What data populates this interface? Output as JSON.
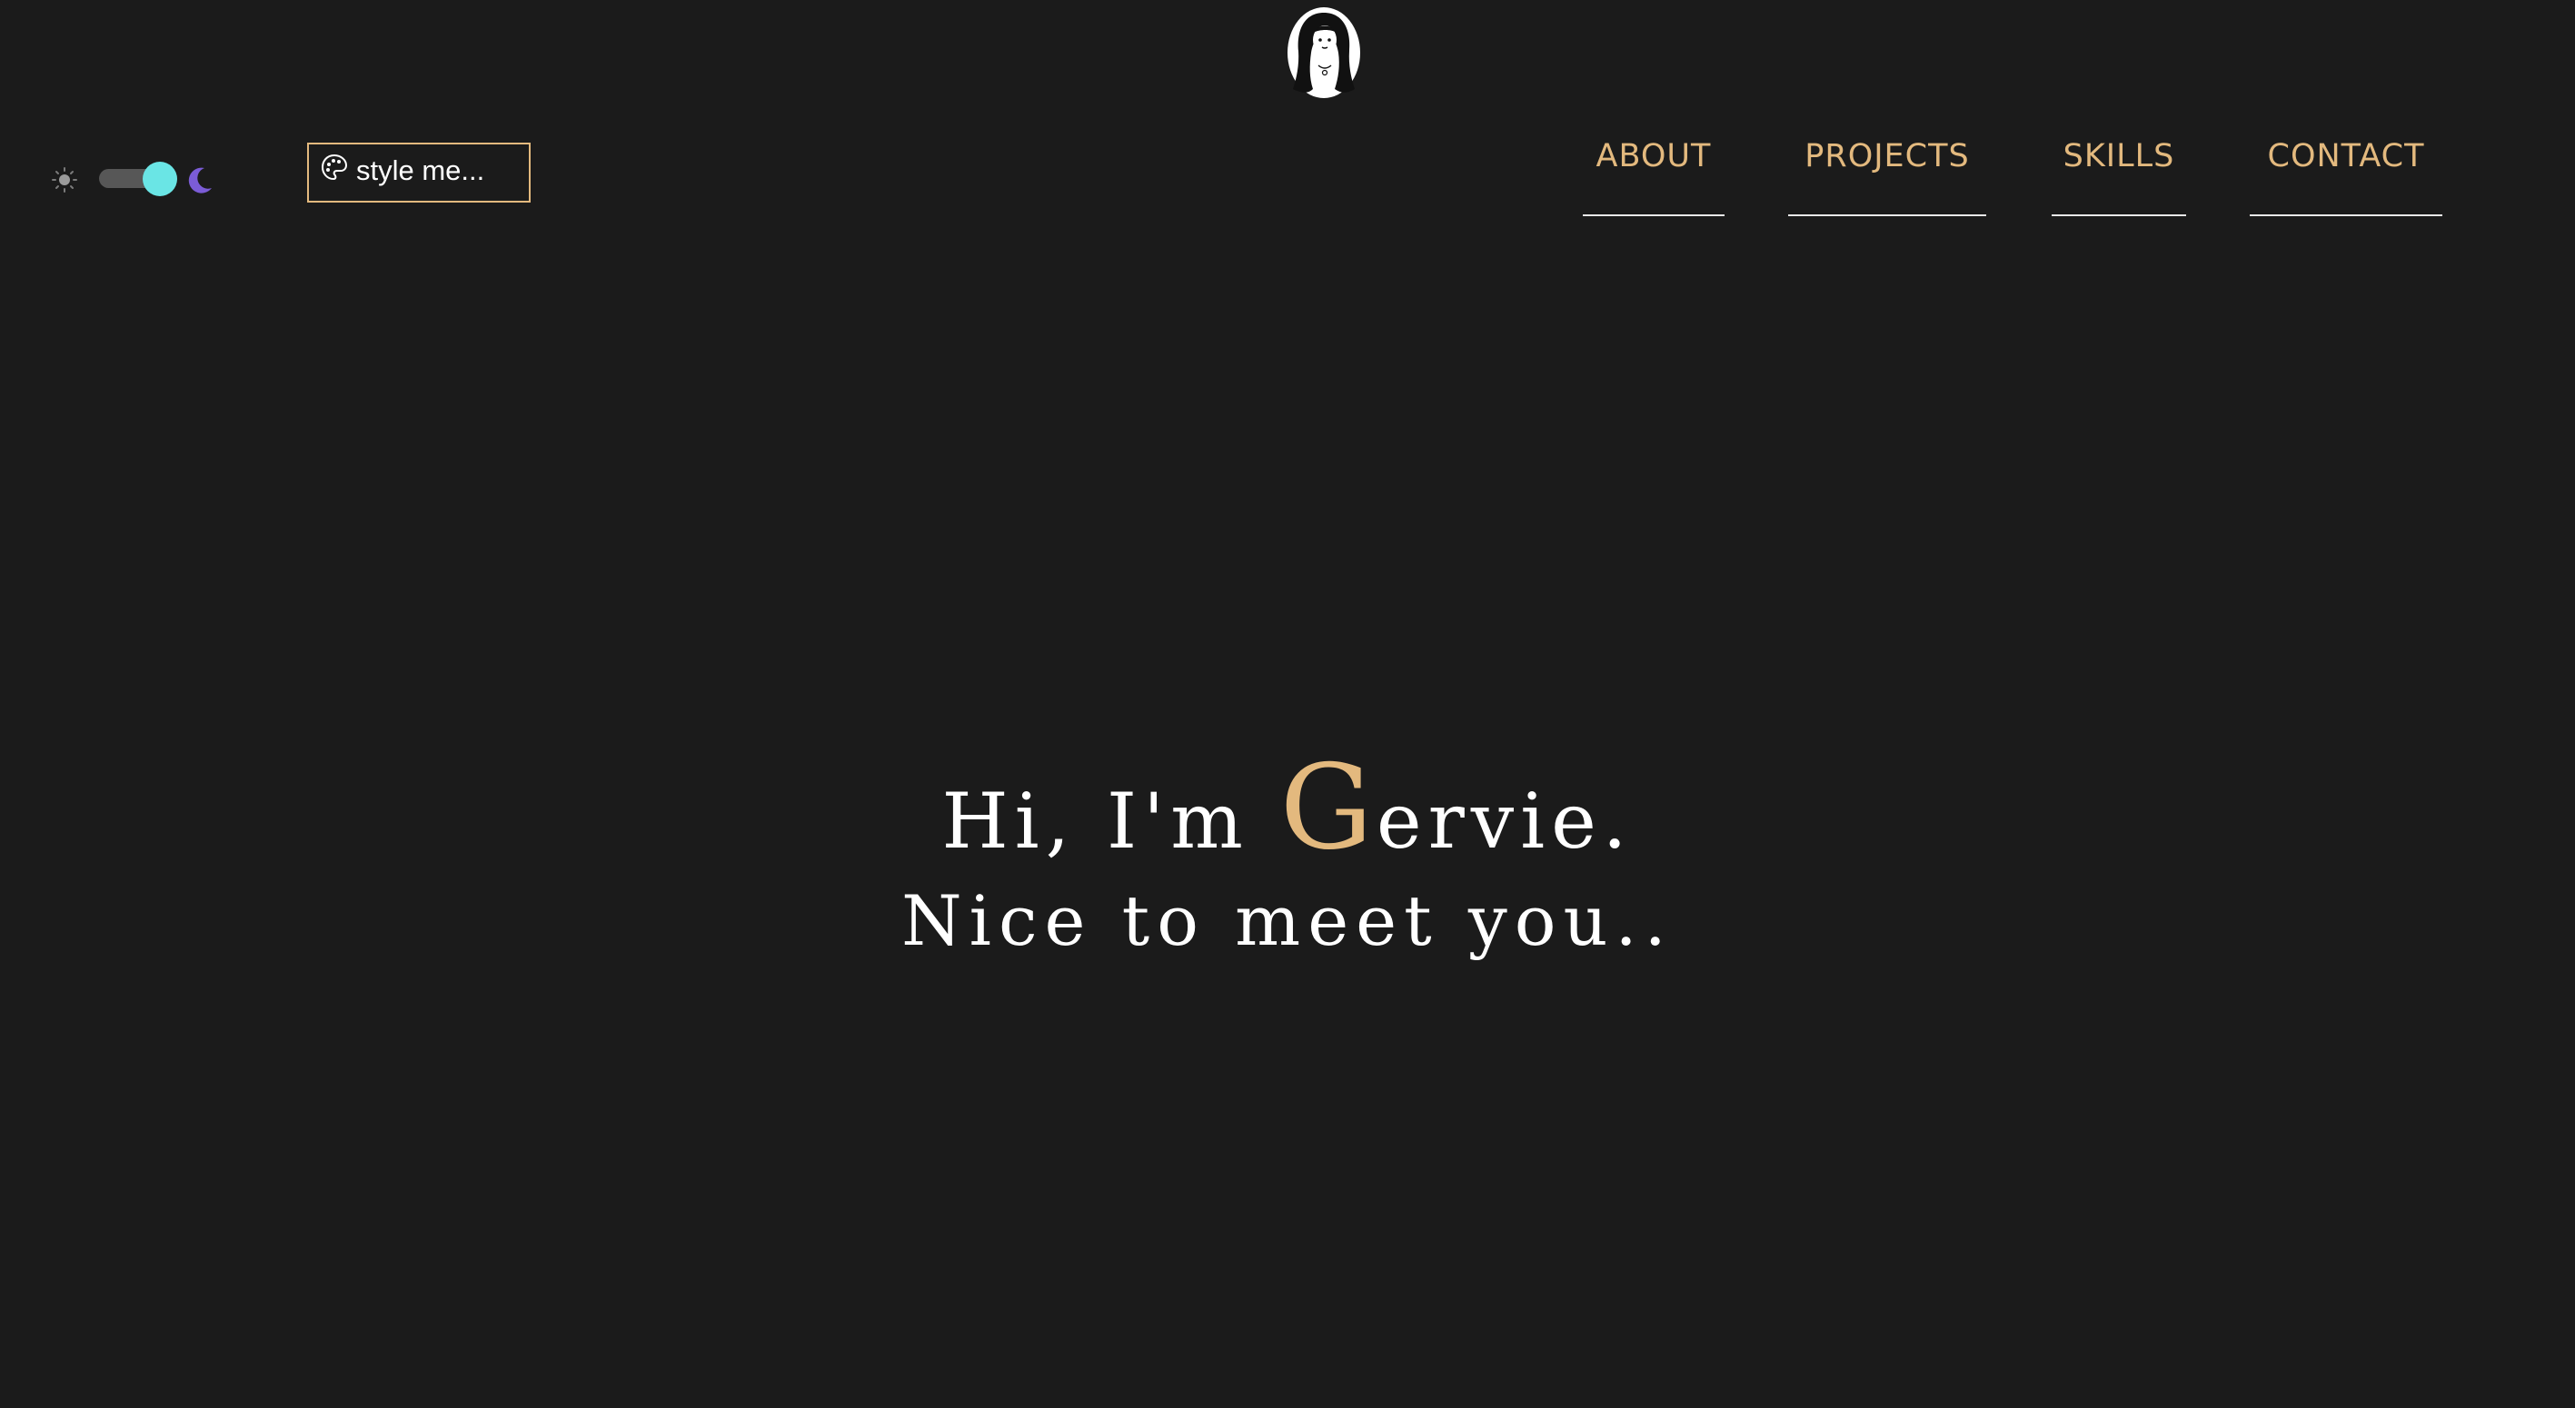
{
  "header": {
    "logo_icon": "avatar-icon",
    "theme_toggle": {
      "light_icon": "sun-icon",
      "dark_icon": "moon-icon",
      "state": "dark"
    },
    "style_button": {
      "icon": "palette-icon",
      "label": "style me..."
    },
    "nav": {
      "items": [
        {
          "label": "ABOUT"
        },
        {
          "label": "PROJECTS"
        },
        {
          "label": "SKILLS"
        },
        {
          "label": "CONTACT"
        }
      ]
    }
  },
  "hero": {
    "greeting_prefix": "Hi, I'm ",
    "name_initial": "G",
    "name_rest": "ervie.",
    "subline": "Nice to meet you.."
  },
  "colors": {
    "background": "#1b1b1b",
    "accent": "#e3b97e",
    "text": "#ffffff",
    "toggle_knob": "#6ae5e5",
    "moon": "#7b5cd6",
    "underline": "#e8e8e8"
  }
}
